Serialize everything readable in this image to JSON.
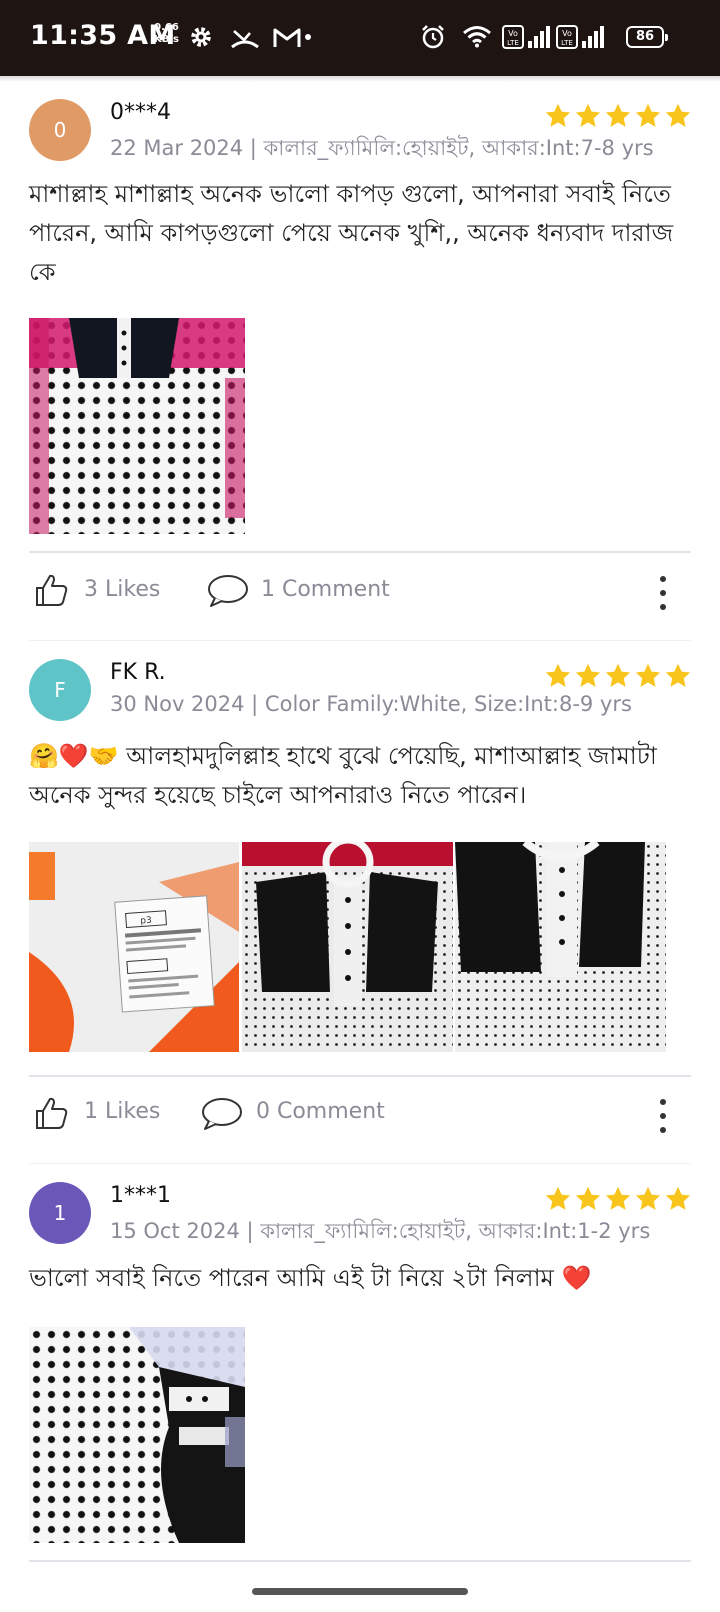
{
  "status_bar": {
    "time": "11:35 AM",
    "speed_value": "0.66",
    "speed_unit": "KB/s",
    "battery": "86"
  },
  "reviews": [
    {
      "initial": "0",
      "avatar_color": "#e09a66",
      "name": "0***4",
      "meta": "22 Mar 2024 | কালার_ফ্যামিলি:হোয়াইট, আকার:Int:7-8 yrs",
      "rating": 5,
      "text": "মাশাল্লাহ মাশাল্লাহ অনেক ভালো কাপড় গুলো, আপনারা সবাই নিতে পারেন, আমি কাপড়গুলো পেয়ে অনেক খুশি,, অনেক ধন্যবাদ দারাজ কে",
      "likes": "3 Likes",
      "comments": "1 Comment"
    },
    {
      "initial": "F",
      "avatar_color": "#5ec4c8",
      "name": "FK R.",
      "meta": "30 Nov 2024 | Color Family:White, Size:Int:8-9 yrs",
      "rating": 5,
      "text": "🤗❤️🤝 আলহামদুলিল্লাহ হাথে বুঝে পেয়েছি, মাশাআল্লাহ জামাটা অনেক সুন্দর হয়েছে চাইলে আপনারাও নিতে পারেন।",
      "likes": "1 Likes",
      "comments": "0 Comment"
    },
    {
      "initial": "1",
      "avatar_color": "#6a57b8",
      "name": "1***1",
      "meta": "15 Oct 2024 | কালার_ফ্যামিলি:হোয়াইট, আকার:Int:1-2 yrs",
      "rating": 5,
      "text": "ভালো সবাই নিতে পারেন আমি এই টা নিয়ে ২টা নিলাম ❤️"
    }
  ],
  "colors": {
    "star": "#f8c51c",
    "muted_text": "#8b8a96",
    "status_bar_bg": "#1e1412"
  }
}
